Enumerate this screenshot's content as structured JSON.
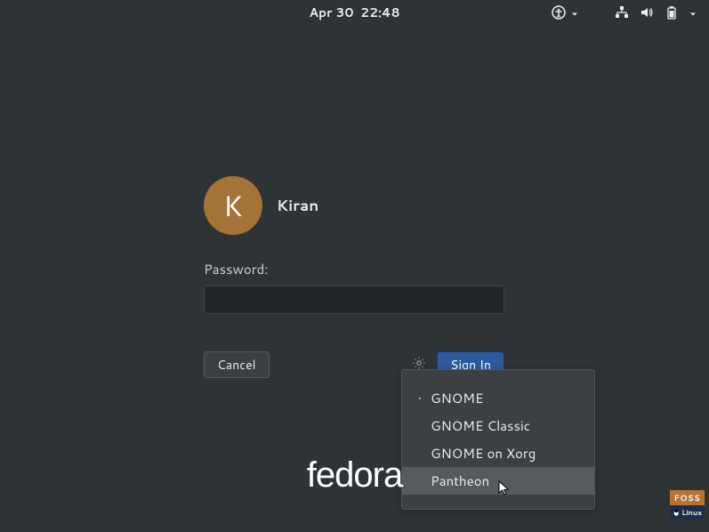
{
  "topbar": {
    "date": "Apr 30",
    "time": "22:48"
  },
  "login": {
    "avatar_initial": "K",
    "username": "Kiran",
    "password_label": "Password:",
    "cancel_label": "Cancel",
    "signin_label": "Sign In"
  },
  "session_menu": {
    "items": [
      {
        "label": "GNOME",
        "selected": true
      },
      {
        "label": "GNOME Classic",
        "selected": false
      },
      {
        "label": "GNOME on Xorg",
        "selected": false
      },
      {
        "label": "Pantheon",
        "selected": false,
        "hover": true
      }
    ]
  },
  "distro_logo": "fedora",
  "badge": {
    "top": "FOSS",
    "bottom": "Linux"
  }
}
